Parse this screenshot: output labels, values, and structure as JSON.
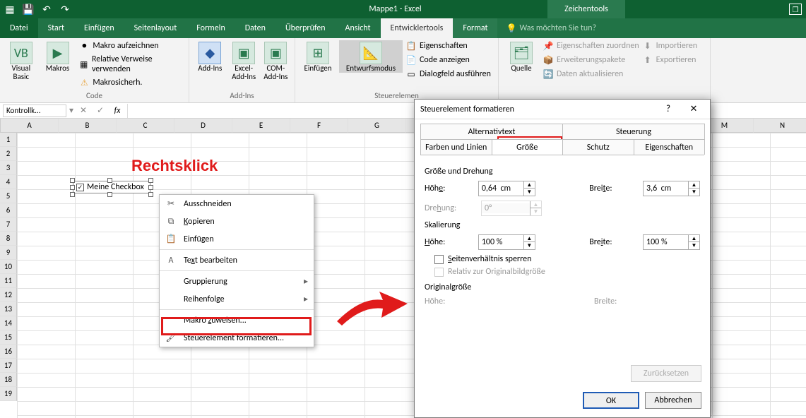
{
  "title": "Mappe1 - Excel",
  "context_tab": "Zeichentools",
  "tabs": {
    "file": "Datei",
    "start": "Start",
    "insert": "Einfügen",
    "layout": "Seitenlayout",
    "formulas": "Formeln",
    "data": "Daten",
    "review": "Überprüfen",
    "view": "Ansicht",
    "developer": "Entwicklertools",
    "format": "Format"
  },
  "tell_me": "Was möchten Sie tun?",
  "ribbon": {
    "code": {
      "visual_basic": "Visual Basic",
      "makros": "Makros",
      "record": "Makro aufzeichnen",
      "relative": "Relative Verweise verwenden",
      "security": "Makrosicherh.",
      "group": "Code"
    },
    "addins": {
      "addins": "Add-Ins",
      "excel_addins": "Excel-Add-Ins",
      "com_addins": "COM-Add-Ins",
      "group": "Add-Ins"
    },
    "controls": {
      "insert": "Einfügen",
      "design": "Entwurfsmodus",
      "properties": "Eigenschaften",
      "view_code": "Code anzeigen",
      "run_dialog": "Dialogfeld ausführen",
      "group": "Steuerelemen"
    },
    "xml": {
      "source": "Quelle",
      "map_props": "Eigenschaften zuordnen",
      "expansion": "Erweiterungspakete",
      "refresh": "Daten aktualisieren",
      "import": "Importieren",
      "export": "Exportieren"
    }
  },
  "namebox_value": "Kontrollk...",
  "columns": [
    "A",
    "B",
    "C",
    "D",
    "E",
    "F",
    "G",
    "M",
    "N"
  ],
  "rows": [
    "1",
    "2",
    "3",
    "4",
    "5",
    "6",
    "7",
    "8",
    "9",
    "10",
    "11",
    "12",
    "13",
    "14",
    "15",
    "16",
    "17",
    "18",
    "19"
  ],
  "checkbox_label": "Meine Checkbox",
  "annot_rightclick": "Rechtsklick",
  "context_menu": {
    "cut": "Ausschneiden",
    "copy": "Kopieren",
    "paste": "Einfügen",
    "edit_text": "Text bearbeiten",
    "grouping": "Gruppierung",
    "order": "Reihenfolge",
    "assign_macro": "Makro zuweisen...",
    "format_control": "Steuerelement formatieren..."
  },
  "dialog": {
    "title": "Steuerelement formatieren",
    "tabs_top": {
      "alt": "Alternativtext",
      "control": "Steuerung"
    },
    "tabs_bottom": {
      "colors": "Farben und Linien",
      "size": "Größe",
      "protection": "Schutz",
      "properties": "Eigenschaften"
    },
    "size_rot": "Größe und Drehung",
    "height_l": "Höhe:",
    "height_v": "0,64  cm",
    "width_l": "Breite:",
    "width_v": "3,6  cm",
    "rotation_l": "Drehung:",
    "rotation_v": "0°",
    "scale": "Skalierung",
    "scale_h_v": "100 %",
    "scale_w_v": "100 %",
    "lock_ratio": "Seitenverhältnis sperren",
    "rel_orig": "Relativ zur Originalbildgröße",
    "orig_size": "Originalgröße",
    "reset": "Zurücksetzen",
    "ok": "OK",
    "cancel": "Abbrechen"
  }
}
